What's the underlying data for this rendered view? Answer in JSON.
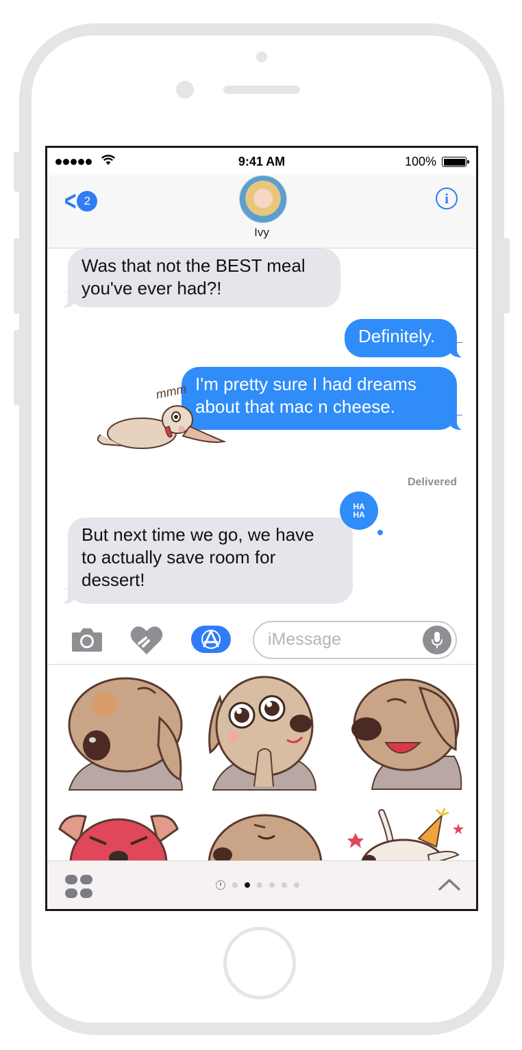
{
  "status_bar": {
    "time": "9:41 AM",
    "battery": "100%"
  },
  "nav": {
    "back_badge": "2",
    "contact_name": "Ivy",
    "info_glyph": "i"
  },
  "messages": [
    {
      "sender": "contact",
      "text_line1": "Was that not the BEST meal",
      "text_line2": "you've ever had?!"
    },
    {
      "sender": "me",
      "text": "Definitely."
    },
    {
      "sender": "me",
      "text_line1": "I'm pretty sure I had dreams",
      "text_line2": "about that mac n cheese."
    },
    {
      "sender": "contact",
      "text_line1": "But next time we go, we have",
      "text_line2": "to actually save room for",
      "text_line3": "dessert!"
    }
  ],
  "sticker_on_message": {
    "caption": "mmm"
  },
  "delivered_label": "Delivered",
  "tapback": {
    "line1": "HA",
    "line2": "HA"
  },
  "input": {
    "placeholder": "iMessage"
  },
  "sticker_pack": {
    "stickers": [
      "dog-sad",
      "dog-pleading",
      "dog-laughing",
      "dog-angry",
      "dog-content",
      "bunny-party"
    ]
  },
  "footer": {
    "pages": 6,
    "active_page": 1
  },
  "colors": {
    "accent": "#2f7cf6",
    "bubble_out": "#2f8cf8",
    "bubble_in": "#e6e5eb"
  }
}
